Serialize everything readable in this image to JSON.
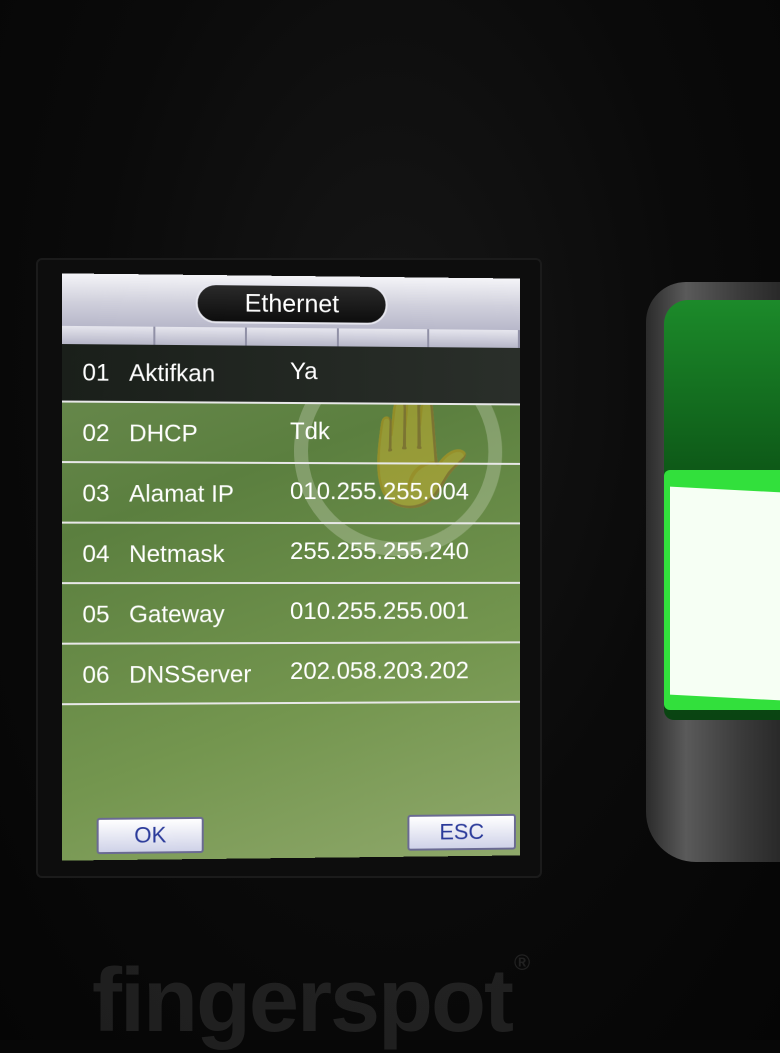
{
  "device": {
    "brand": "fingerspot",
    "trademark": "®"
  },
  "screen": {
    "title": "Ethernet",
    "rows": [
      {
        "num": "01",
        "label": "Aktifkan",
        "value": "Ya"
      },
      {
        "num": "02",
        "label": "DHCP",
        "value": "Tdk"
      },
      {
        "num": "03",
        "label": "Alamat IP",
        "value": "010.255.255.004"
      },
      {
        "num": "04",
        "label": "Netmask",
        "value": "255.255.255.240"
      },
      {
        "num": "05",
        "label": "Gateway",
        "value": "010.255.255.001"
      },
      {
        "num": "06",
        "label": "DNSServer",
        "value": "202.058.203.202"
      }
    ],
    "selected_row": "01",
    "buttons": {
      "ok": "OK",
      "esc": "ESC"
    }
  },
  "colors": {
    "screen_green": "#5b7f3f",
    "selected_row": "#1a1f1a",
    "button_text": "#2a3a9a",
    "sensor_glow": "#32e03c"
  }
}
